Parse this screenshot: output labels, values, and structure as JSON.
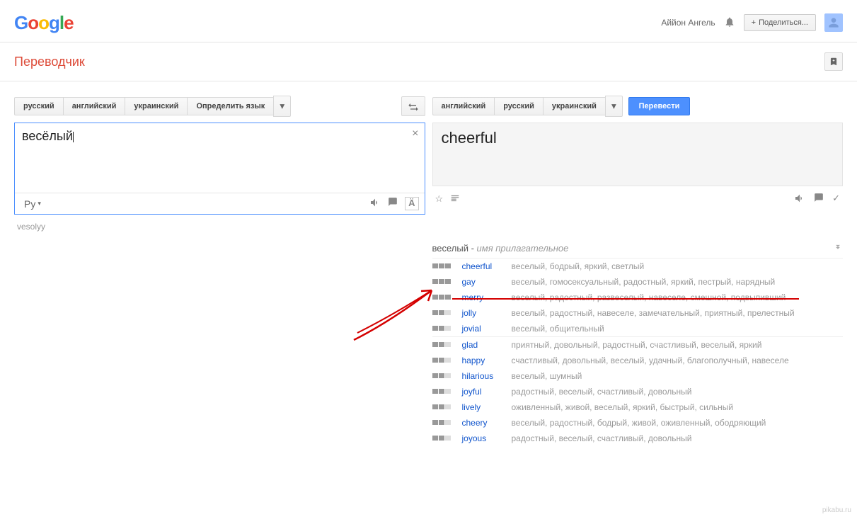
{
  "header": {
    "logo_letters": [
      "G",
      "o",
      "o",
      "g",
      "l",
      "e"
    ],
    "username": "Аййон Ангель",
    "share_label": "Поделиться..."
  },
  "app_title": "Переводчик",
  "source_langs": [
    "русский",
    "английский",
    "украинский",
    "Определить язык"
  ],
  "target_langs": [
    "английский",
    "русский",
    "украинский"
  ],
  "translate_btn": "Перевести",
  "input_text": "весёлый",
  "input_method_label": "Ру",
  "transliteration": "vesolyy",
  "output_text": "cheerful",
  "dict": {
    "word": "веселый",
    "pos": "имя прилагательное",
    "groups": [
      [
        {
          "freq": 3,
          "word": "cheerful",
          "trans": "веселый, бодрый, яркий, светлый"
        },
        {
          "freq": 3,
          "word": "gay",
          "trans": "веселый, гомосексуальный, радостный, яркий, пестрый, нарядный"
        },
        {
          "freq": 3,
          "word": "merry",
          "trans": "веселый, радостный, развеселый, навеселе, смешной, подвыпивший"
        },
        {
          "freq": 2,
          "word": "jolly",
          "trans": "веселый, радостный, навеселе, замечательный, приятный, прелестный"
        },
        {
          "freq": 2,
          "word": "jovial",
          "trans": "веселый, общительный"
        }
      ],
      [
        {
          "freq": 2,
          "word": "glad",
          "trans": "приятный, довольный, радостный, счастливый, веселый, яркий"
        },
        {
          "freq": 2,
          "word": "happy",
          "trans": "счастливый, довольный, веселый, удачный, благополучный, навеселе"
        },
        {
          "freq": 2,
          "word": "hilarious",
          "trans": "веселый, шумный"
        },
        {
          "freq": 2,
          "word": "joyful",
          "trans": "радостный, веселый, счастливый, довольный"
        },
        {
          "freq": 2,
          "word": "lively",
          "trans": "оживленный, живой, веселый, яркий, быстрый, сильный"
        },
        {
          "freq": 2,
          "word": "cheery",
          "trans": "веселый, радостный, бодрый, живой, оживленный, ободряющий"
        },
        {
          "freq": 2,
          "word": "joyous",
          "trans": "радостный, веселый, счастливый, довольный"
        }
      ]
    ]
  },
  "watermark": "pikabu.ru"
}
